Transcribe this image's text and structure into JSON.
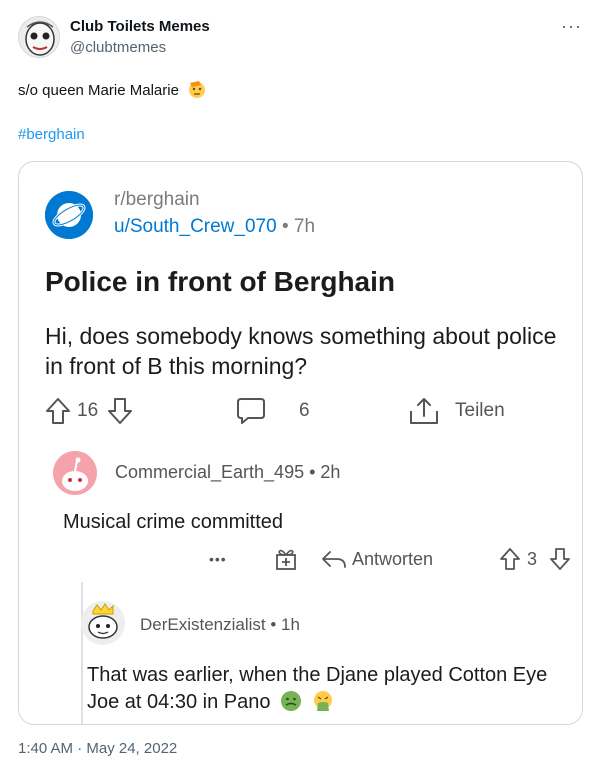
{
  "tweet": {
    "author_name": "Club Toilets Memes",
    "author_handle": "@clubtmemes",
    "more_label": "···",
    "text": "s/o queen Marie Malarie",
    "hashtag": "#berghain",
    "timestamp": "1:40 AM · May 24, 2022"
  },
  "reddit_post": {
    "subreddit": "r/berghain",
    "user": "u/South_Crew_070",
    "time": " • 7h",
    "title": "Police in front of Berghain",
    "body": "Hi, does somebody knows something about police in front of B this morning?",
    "votes": "16",
    "comments_count": "6",
    "share_label": "Teilen",
    "comment1": {
      "user": "Commercial_Earth_495",
      "time": " • 2h",
      "text": "Musical crime committed",
      "more_label": "•••",
      "reply_label": "Antworten",
      "votes": "3"
    },
    "comment2": {
      "user": "DerExistenzialist",
      "time": " • 1h",
      "text": "That was earlier, when the Djane played Cotton Eye Joe at 04:30 in Pano"
    }
  },
  "colors": {
    "twitter_blue": "#1d9bf0",
    "reddit_blue": "#0079d3",
    "text": "#0f1419",
    "muted": "#536471"
  },
  "icons": [
    "face-avatar-icon",
    "saluting-face-icon",
    "reddit-planet-icon",
    "upvote-icon",
    "downvote-icon",
    "comment-icon",
    "share-icon",
    "award-icon",
    "reply-icon",
    "snoo-avatar-icon",
    "nauseated-face-icon",
    "vomiting-face-icon"
  ]
}
